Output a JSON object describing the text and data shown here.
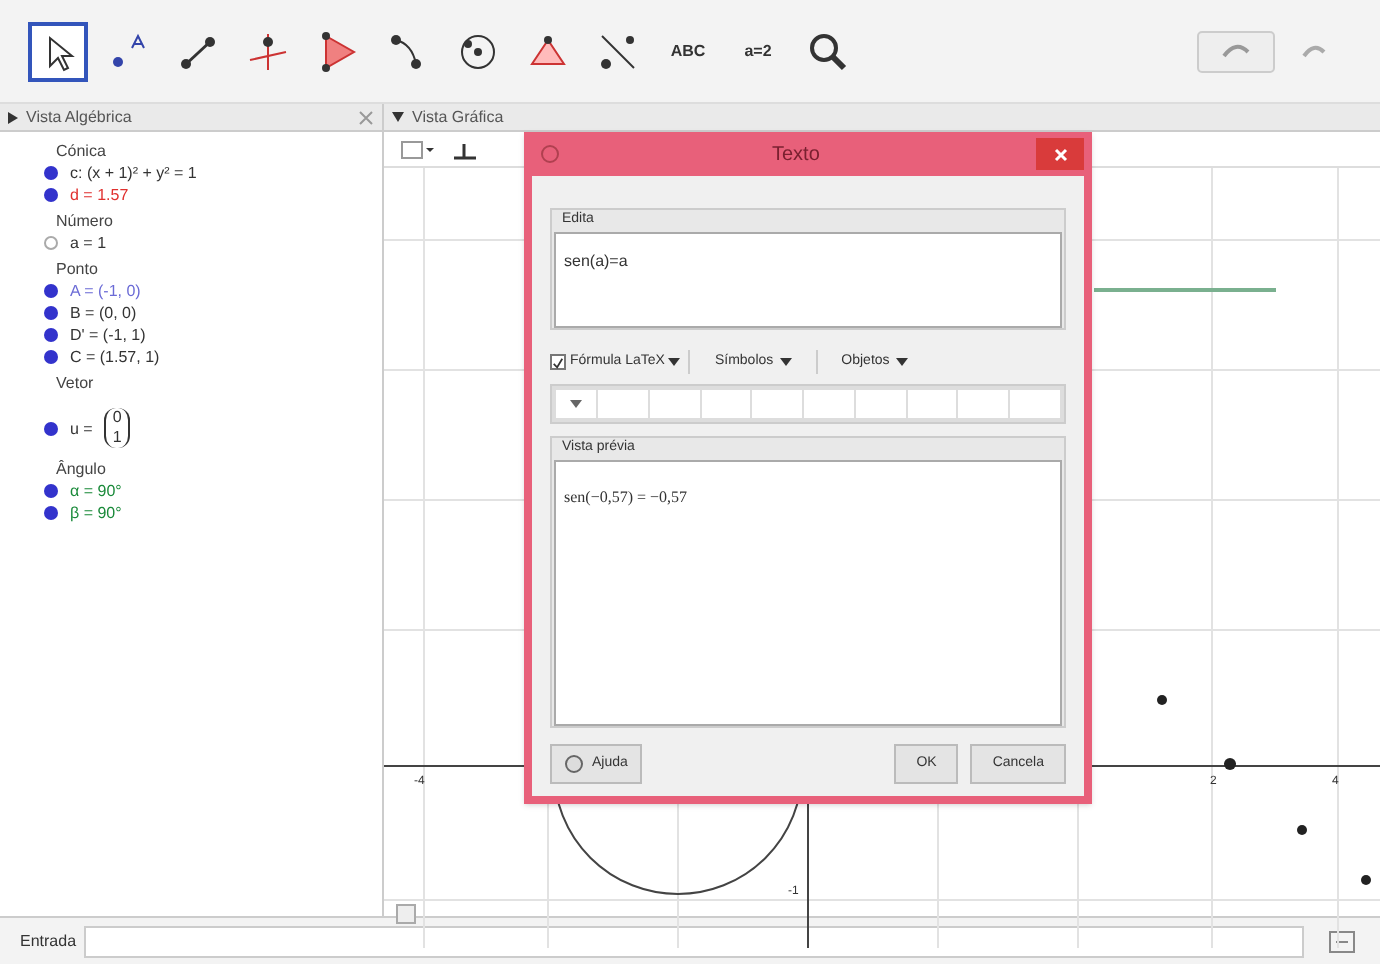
{
  "toolbar": {
    "tools": [
      {
        "selected": true
      },
      {
        "selected": false
      },
      {
        "selected": false
      },
      {
        "selected": false
      },
      {
        "selected": false
      },
      {
        "selected": false
      },
      {
        "selected": false
      },
      {
        "selected": false
      },
      {
        "selected": false
      },
      {
        "selected": false,
        "label": "ABC"
      },
      {
        "selected": false,
        "label": "a=2"
      },
      {
        "selected": false
      }
    ]
  },
  "algebra_view": {
    "title": "Vista Algébrica",
    "groups": [
      {
        "name": "Cónica",
        "items": [
          {
            "text": "c: (x + 1)² + y² = 1",
            "visible": true,
            "color": "#333333"
          },
          {
            "text": "d = 1.57",
            "visible": true,
            "color": "#e0302e"
          }
        ]
      },
      {
        "name": "Número",
        "items": [
          {
            "text": "a = 1",
            "visible": false,
            "color": "#333333"
          }
        ]
      },
      {
        "name": "Ponto",
        "items": [
          {
            "text": "A = (-1, 0)",
            "visible": true,
            "color": "#6b6bd6"
          },
          {
            "text": "B = (0, 0)",
            "visible": true,
            "color": "#333333"
          },
          {
            "text": "D' = (-1, 1)",
            "visible": true,
            "color": "#333333"
          },
          {
            "text": "C = (1.57, 1)",
            "visible": true,
            "color": "#333333"
          }
        ]
      },
      {
        "name": "Vetor",
        "items": [
          {
            "kind": "vector",
            "text": "u =",
            "matrix": [
              "0",
              "1"
            ],
            "visible": true,
            "color": "#333333"
          }
        ]
      },
      {
        "name": "Ângulo",
        "items": [
          {
            "text": "α = 90°",
            "visible": true,
            "color": "#1a8a3a"
          },
          {
            "text": "β = 90°",
            "visible": true,
            "color": "#1a8a3a"
          }
        ]
      }
    ]
  },
  "graphics_view": {
    "title": "Vista Gráfica",
    "tick_labels": [
      "-4",
      "-1",
      "2",
      "4"
    ]
  },
  "dialog": {
    "title": "Texto",
    "edit_label": "Edita",
    "edit_value": "sen(a)=a",
    "latex": {
      "label": "Fórmula LaTeX",
      "checked": true
    },
    "menus": [
      "Símbolos",
      "Objetos"
    ],
    "preview_label": "Vista prévia",
    "preview": "sen(−0,57) = −0,57",
    "buttons": [
      "Ajuda",
      "OK",
      "Cancela"
    ]
  },
  "input_bar": {
    "label": "Entrada"
  }
}
